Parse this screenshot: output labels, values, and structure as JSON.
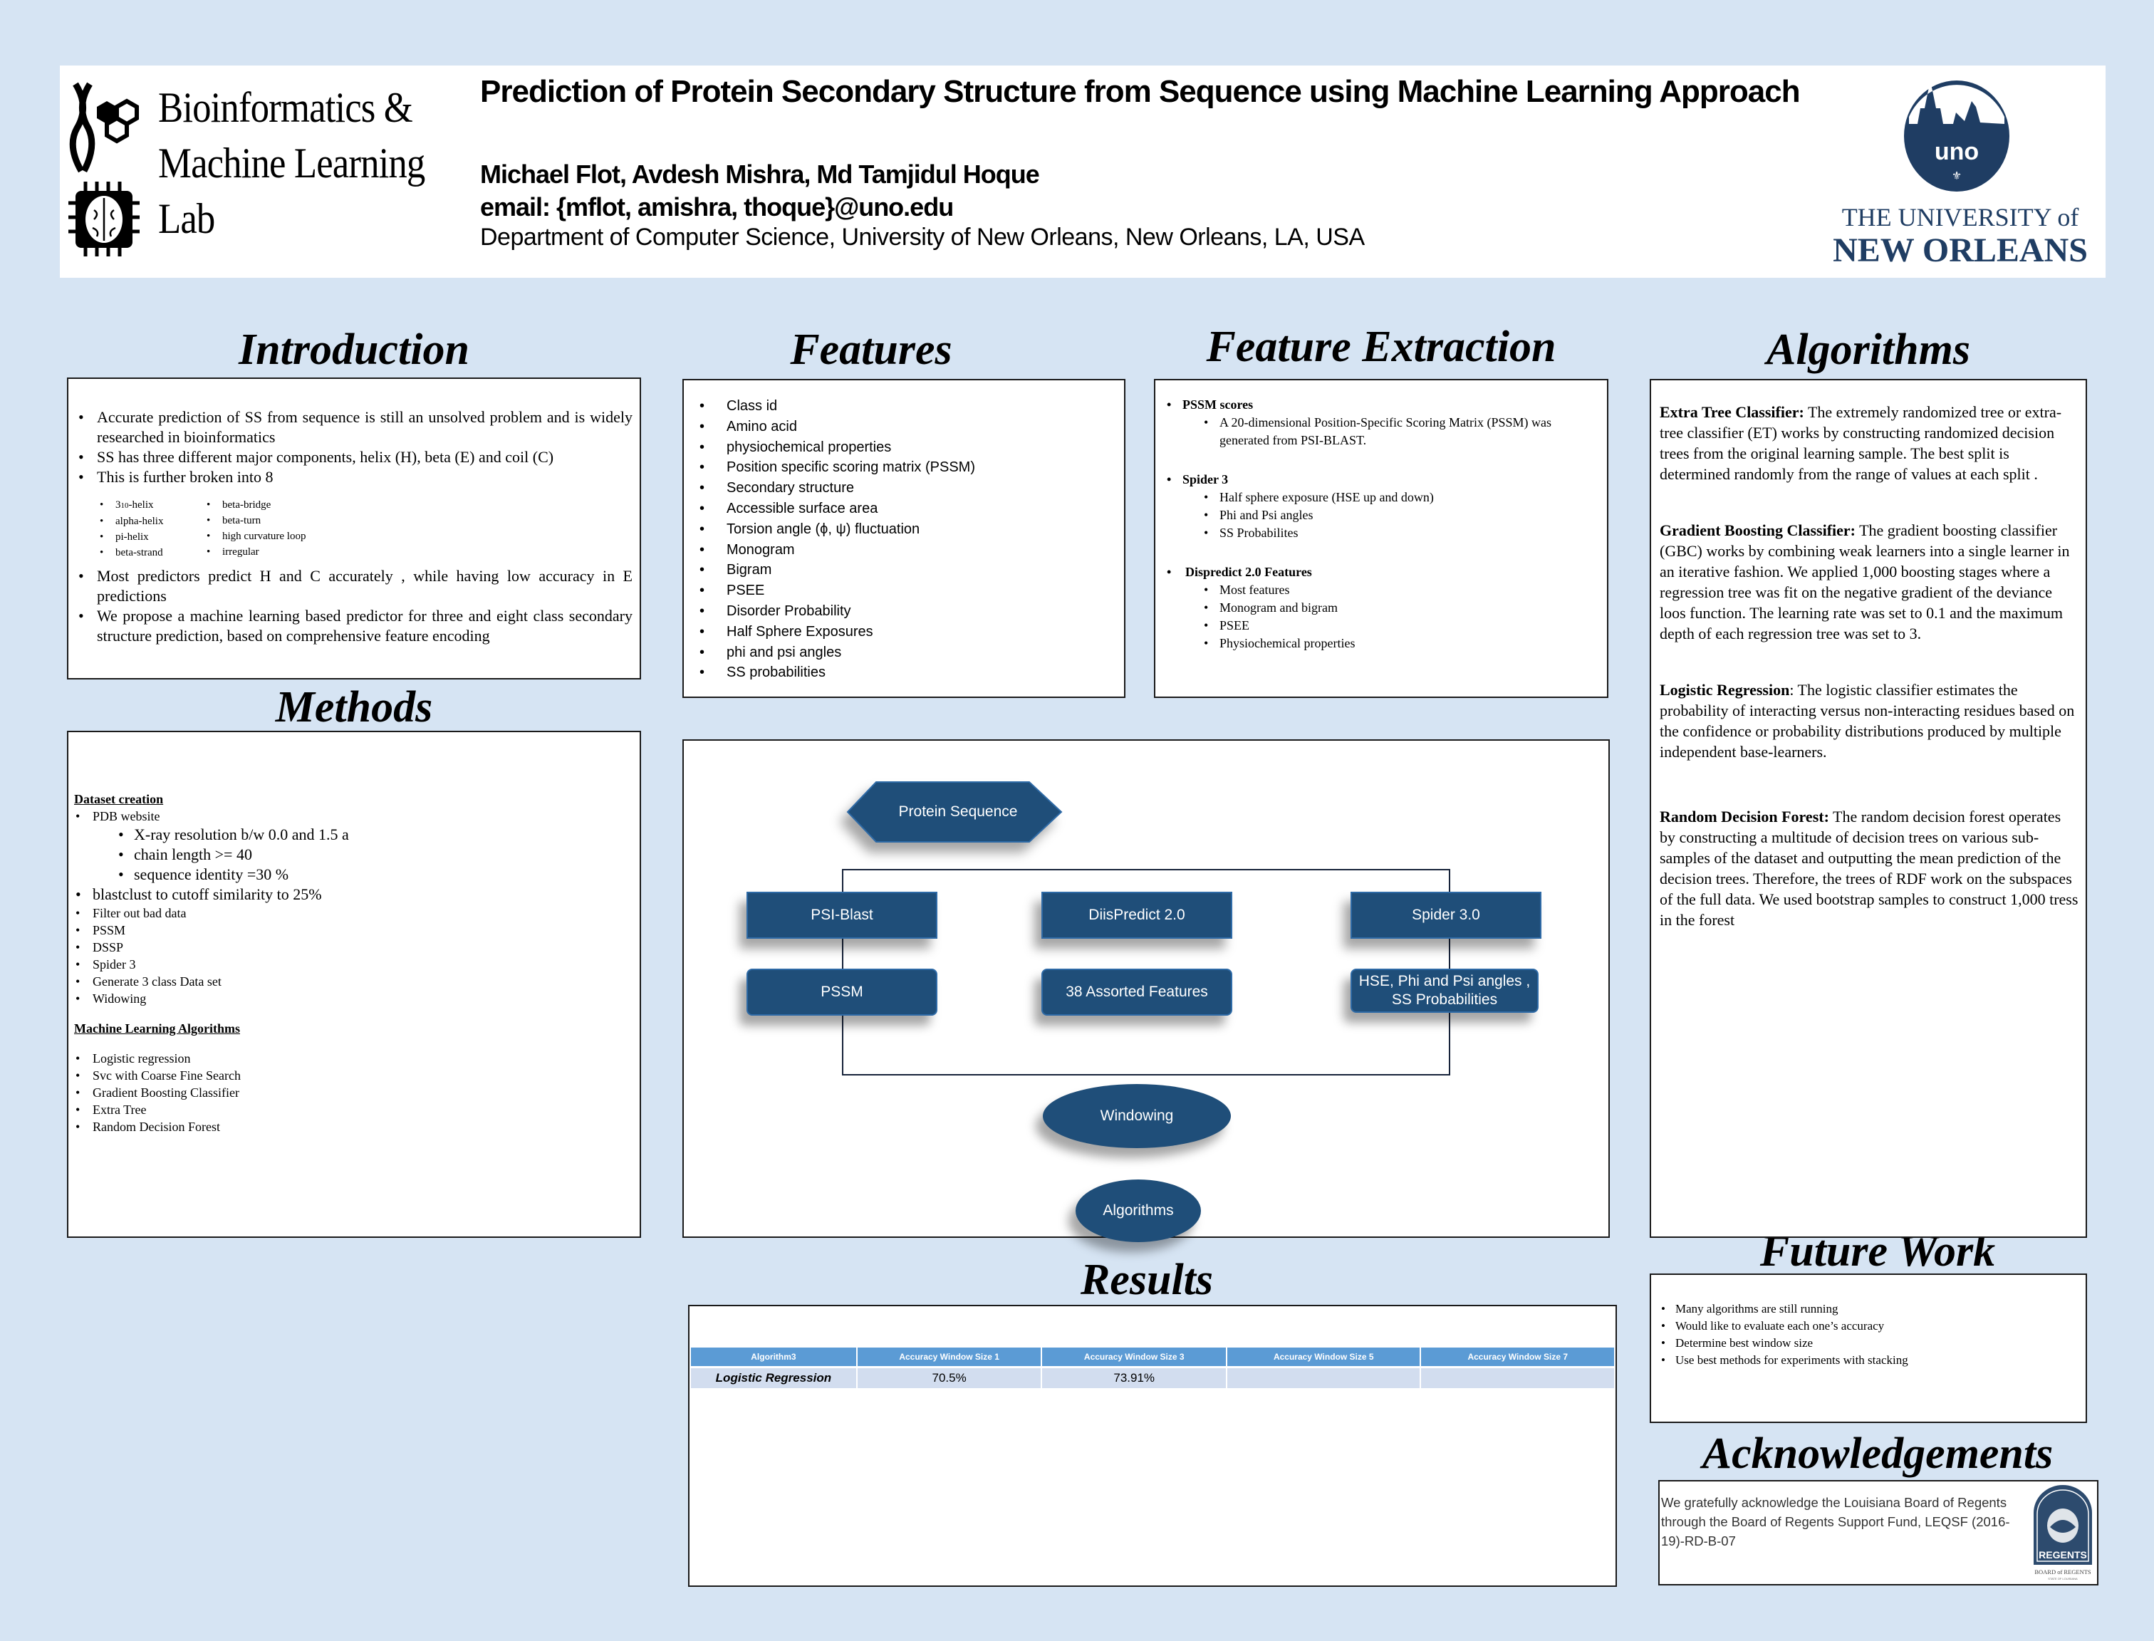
{
  "header": {
    "lab_name_lines": [
      "Bioinformatics &",
      "Machine Learning",
      "Lab"
    ],
    "title": "Prediction of Protein Secondary Structure from Sequence using Machine Learning Approach",
    "authors": "Michael Flot, Avdesh Mishra, Md Tamjidul Hoque",
    "email": "email: {mflot, amishra, thoque}@uno.edu",
    "department": "Department of Computer Science, University of New Orleans, New Orleans, LA, USA",
    "university_logo": {
      "seal_text": "uno",
      "line1": "THE UNIVERSITY of",
      "line2": "NEW ORLEANS"
    }
  },
  "sections": {
    "introduction": "Introduction",
    "methods": "Methods",
    "features": "Features",
    "feature_extraction": "Feature Extraction",
    "algorithms": "Algorithms",
    "results": "Results",
    "future_work": "Future Work",
    "acknowledgements": "Acknowledgements"
  },
  "introduction": {
    "bullets_top": [
      "Accurate prediction of SS from sequence is still an unsolved problem and is widely researched in bioinformatics",
      "SS has three different major components, helix (H), beta (E) and coil (C)",
      "This is further broken into 8"
    ],
    "eight_classes": {
      "col1": [
        "3-10-helix",
        "alpha-helix",
        "pi-helix",
        "beta-strand"
      ],
      "col2": [
        "beta-bridge",
        "beta-turn",
        "high curvature loop",
        "irregular"
      ]
    },
    "bullets_bottom": [
      "Most predictors predict H and C accurately , while having low accuracy in E predictions",
      "We propose a machine learning based predictor for three and eight class secondary structure prediction, based on comprehensive feature encoding"
    ]
  },
  "methods": {
    "dataset_heading": "Dataset creation",
    "pdb": "PDB website",
    "pdb_sub": [
      "X-ray resolution b/w 0.0 and 1.5 a",
      "chain length >= 40",
      "sequence identity =30 %"
    ],
    "blastclust": "blastclust to cutoff similarity to 25%",
    "steps": [
      "Filter out bad data",
      "PSSM",
      "DSSP",
      "Spider 3",
      "Generate 3 class Data set",
      "Widowing"
    ],
    "ml_heading": "Machine Learning Algorithms",
    "ml_items": [
      "Logistic regression",
      "Svc with Coarse Fine Search",
      "Gradient Boosting Classifier",
      "Extra Tree",
      "Random Decision Forest"
    ]
  },
  "features": {
    "items": [
      "Class id",
      "Amino acid",
      "physiochemical properties",
      "Position specific scoring matrix (PSSM)",
      "Secondary structure",
      "Accessible surface area",
      "Torsion angle (ϕ, ψ) fluctuation",
      "Monogram",
      "Bigram",
      "PSEE",
      "Disorder Probability",
      "Half Sphere Exposures",
      "phi and psi angles",
      "SS probabilities"
    ]
  },
  "feature_extraction": {
    "groups": [
      {
        "title": "PSSM scores",
        "items": [
          "A 20-dimensional Position-Specific Scoring Matrix (PSSM) was generated from PSI-BLAST."
        ]
      },
      {
        "title": "Spider 3",
        "items": [
          "Half sphere exposure (HSE up and down)",
          "Phi and Psi angles",
          "SS Probabilites"
        ]
      },
      {
        "title": "Dispredict 2.0 Features",
        "items": [
          "Most features",
          "Monogram and bigram",
          "PSEE",
          "Physiochemical properties"
        ]
      }
    ]
  },
  "algorithms": [
    {
      "name": "Extra Tree Classifier:",
      "text": " The extremely randomized tree or extra-tree classifier (ET) works by constructing randomized decision trees from the original learning sample. The best split is determined randomly from the range of values at each split ."
    },
    {
      "name": "Gradient Boosting Classifier:",
      "text": "  The gradient boosting classifier (GBC) works by combining weak learners into a single learner in an iterative fashion. We applied 1,000 boosting stages where a regression tree was fit on the negative gradient of the deviance loos function. The learning rate was set to 0.1 and the maximum depth of each regression tree was set to 3."
    },
    {
      "name": "Logistic Regression",
      "text": ": The logistic classifier estimates the probability of interacting versus non-interacting residues based on the confidence or probability distributions produced by multiple independent base-learners."
    },
    {
      "name": "Random Decision Forest:",
      "text": " The random decision forest operates by constructing a multitude of decision trees on various sub-samples of the dataset and outputting the mean prediction of the decision trees. Therefore, the trees of RDF work on the subspaces of the full data. We used bootstrap samples to construct 1,000 tress in the forest"
    }
  ],
  "diagram": {
    "root": "Protein Sequence",
    "tools": [
      "PSI-Blast",
      "DiisPredict 2.0",
      "Spider 3.0"
    ],
    "outputs": [
      "PSSM",
      "38 Assorted Features",
      "HSE, Phi and Psi angles , SS Probabilities"
    ],
    "windowing": "Windowing",
    "algorithms": "Algorithms",
    "node_color": "#1f4e79"
  },
  "results": {
    "headers": [
      "Algorithm3",
      "Accuracy Window Size 1",
      "Accuracy Window Size 3",
      "Accuracy Window Size 5",
      "Accuracy Window Size 7"
    ],
    "rows": [
      [
        "Logistic Regression",
        "70.5%",
        "73.91%",
        "",
        ""
      ]
    ],
    "header_color": "#5b9bd5",
    "row_color": "#d2ddef"
  },
  "future_work": {
    "items": [
      "Many algorithms are still running",
      "Would like to evaluate each one’s accuracy",
      "Determine best window size",
      "Use best methods for experiments with stacking"
    ]
  },
  "acknowledgements": {
    "text": "We gratefully acknowledge the Louisiana Board of Regents through the Board of Regents Support Fund, LEQSF (2016-19)-RD-B-07",
    "logo_label": "REGENTS",
    "logo_caption": "BOARD of REGENTS",
    "logo_subcaption": "STATE OF LOUISIANA"
  }
}
